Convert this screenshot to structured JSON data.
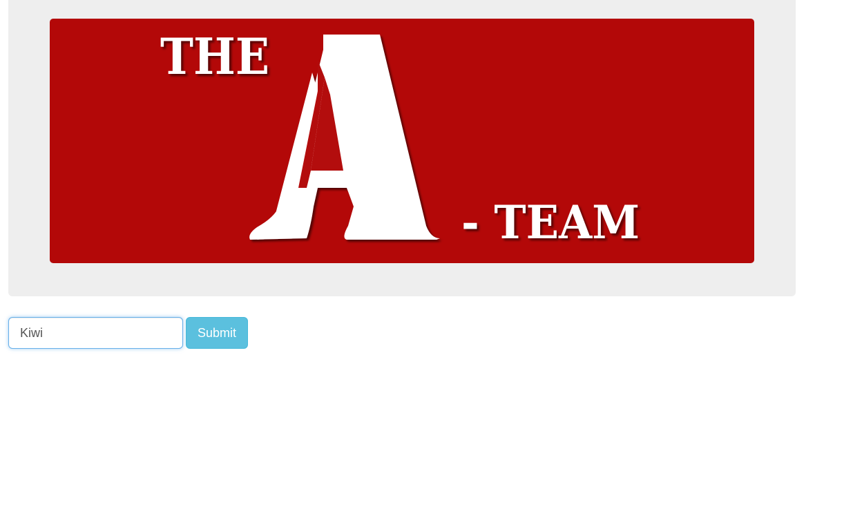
{
  "logo": {
    "line_the": "THE",
    "letter_a": "A",
    "line_team": "- TEAM",
    "background_color": "#b30808",
    "text_color": "#ffffff"
  },
  "form": {
    "input_value": "Kiwi",
    "submit_label": "Submit",
    "submit_color": "#5bc0de",
    "input_focus_color": "#66afe9"
  }
}
